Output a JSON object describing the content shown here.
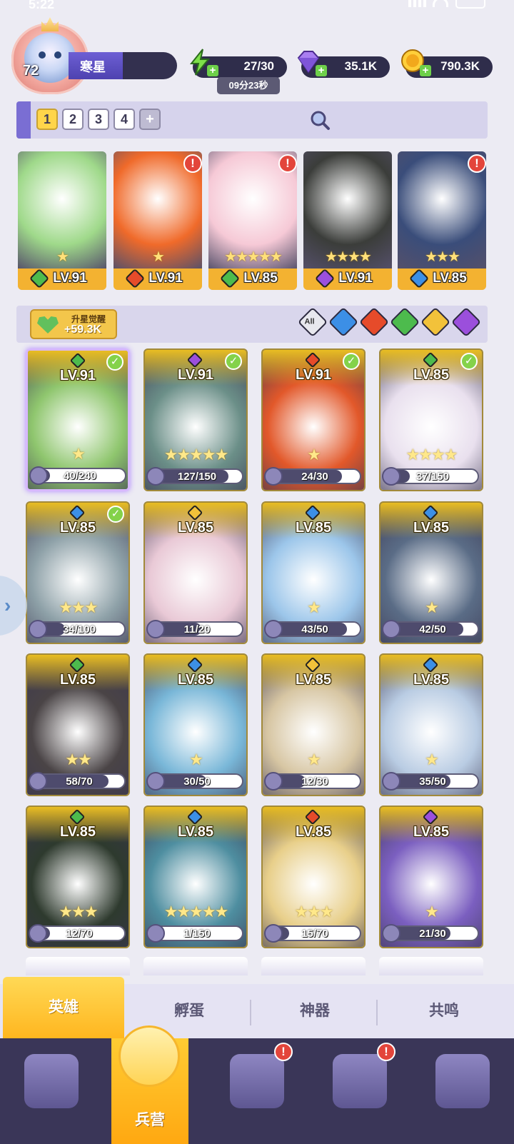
{
  "status": {
    "time": "5:22",
    "battery": "45"
  },
  "player": {
    "level": "72",
    "name": "寒星"
  },
  "resources": {
    "energy": "27/30",
    "energy_timer": "09分23秒",
    "gems": "35.1K",
    "coins": "790.3K"
  },
  "team_slots": [
    "1",
    "2",
    "3",
    "4",
    "+"
  ],
  "team_heroes": [
    {
      "level": "LV.91",
      "element": "nature",
      "stars": "★",
      "alert": "",
      "bg": "#9fd98a"
    },
    {
      "level": "LV.91",
      "element": "fire",
      "stars": "★",
      "alert": "!",
      "bg": "#f06a2a"
    },
    {
      "level": "LV.85",
      "element": "nature",
      "stars": "★★★★★",
      "alert": "!",
      "bg": "#f6c9d6"
    },
    {
      "level": "LV.91",
      "element": "dark",
      "stars": "★★★★",
      "alert": "",
      "bg": "#3b3d3a"
    },
    {
      "level": "LV.85",
      "element": "water",
      "stars": "★★★",
      "alert": "!",
      "bg": "#3a4d7a"
    }
  ],
  "upstar": {
    "label": "升星觉醒",
    "value": "+59.3K"
  },
  "filters": [
    {
      "name": "all",
      "label": "All",
      "color": "#e8e8ee"
    },
    {
      "name": "water",
      "color": "#3c8fe6"
    },
    {
      "name": "fire",
      "color": "#e64b2a"
    },
    {
      "name": "nature",
      "color": "#4dbb4d"
    },
    {
      "name": "light",
      "color": "#f2c23a"
    },
    {
      "name": "dark",
      "color": "#9b4fdc"
    }
  ],
  "heroes": [
    {
      "level": "LV.91",
      "element": "nature",
      "stars": "★",
      "progress": "40/240",
      "fraction": 0.1667,
      "checked": true,
      "selected": true,
      "bg": "#8fc66e"
    },
    {
      "level": "LV.91",
      "element": "dark",
      "stars": "★★★★★",
      "progress": "127/150",
      "fraction": 0.8467,
      "checked": true,
      "selected": false,
      "bg": "#6b8f88"
    },
    {
      "level": "LV.91",
      "element": "fire",
      "stars": "★",
      "progress": "24/30",
      "fraction": 0.8,
      "checked": true,
      "selected": false,
      "bg": "#e2582a"
    },
    {
      "level": "LV.85",
      "element": "nature",
      "stars": "★★★★",
      "progress": "37/150",
      "fraction": 0.2467,
      "checked": true,
      "selected": false,
      "bg": "#e9e0ee"
    },
    {
      "level": "LV.85",
      "element": "water",
      "stars": "★★★",
      "progress": "34/100",
      "fraction": 0.34,
      "checked": true,
      "selected": false,
      "bg": "#8ea1a8"
    },
    {
      "level": "LV.85",
      "element": "light",
      "stars": "",
      "progress": "11/20",
      "fraction": 0.55,
      "checked": false,
      "selected": false,
      "bg": "#e9c9d6"
    },
    {
      "level": "LV.85",
      "element": "water",
      "stars": "★",
      "progress": "43/50",
      "fraction": 0.86,
      "checked": false,
      "selected": false,
      "bg": "#9cc6ea"
    },
    {
      "level": "LV.85",
      "element": "water",
      "stars": "★",
      "progress": "42/50",
      "fraction": 0.84,
      "checked": false,
      "selected": false,
      "bg": "#5a6c86"
    },
    {
      "level": "LV.85",
      "element": "nature",
      "stars": "★★",
      "progress": "58/70",
      "fraction": 0.8286,
      "checked": false,
      "selected": false,
      "bg": "#4a4446"
    },
    {
      "level": "LV.85",
      "element": "water",
      "stars": "★",
      "progress": "30/50",
      "fraction": 0.6,
      "checked": false,
      "selected": false,
      "bg": "#79b7d8"
    },
    {
      "level": "LV.85",
      "element": "light",
      "stars": "★",
      "progress": "12/30",
      "fraction": 0.4,
      "checked": false,
      "selected": false,
      "bg": "#d7c6a3"
    },
    {
      "level": "LV.85",
      "element": "water",
      "stars": "★",
      "progress": "35/50",
      "fraction": 0.7,
      "checked": false,
      "selected": false,
      "bg": "#b9cce3"
    },
    {
      "level": "LV.85",
      "element": "nature",
      "stars": "★★★",
      "progress": "12/70",
      "fraction": 0.1714,
      "checked": false,
      "selected": false,
      "bg": "#2e3a2e"
    },
    {
      "level": "LV.85",
      "element": "water",
      "stars": "★★★★★",
      "progress": "1/150",
      "fraction": 0.0067,
      "checked": false,
      "selected": false,
      "bg": "#4e8ea0"
    },
    {
      "level": "LV.85",
      "element": "fire",
      "stars": "★★★",
      "progress": "15/70",
      "fraction": 0.2143,
      "checked": false,
      "selected": false,
      "bg": "#e8cf8a"
    },
    {
      "level": "LV.85",
      "element": "dark",
      "stars": "★",
      "progress": "21/30",
      "fraction": 0.7,
      "checked": false,
      "selected": false,
      "bg": "#7b5fc0"
    }
  ],
  "subtabs": [
    "英雄",
    "孵蛋",
    "神器",
    "共鸣"
  ],
  "nav": [
    {
      "name": "cards",
      "label": "",
      "alert": ""
    },
    {
      "name": "barracks",
      "label": "兵营",
      "alert": ""
    },
    {
      "name": "map",
      "label": "",
      "alert": "!"
    },
    {
      "name": "castle",
      "label": "",
      "alert": "!"
    },
    {
      "name": "mushroom",
      "label": "",
      "alert": ""
    }
  ],
  "element_colors": {
    "nature": "#4dbb4d",
    "fire": "#e64b2a",
    "water": "#3c8fe6",
    "dark": "#9b4fdc",
    "light": "#f2c23a"
  }
}
